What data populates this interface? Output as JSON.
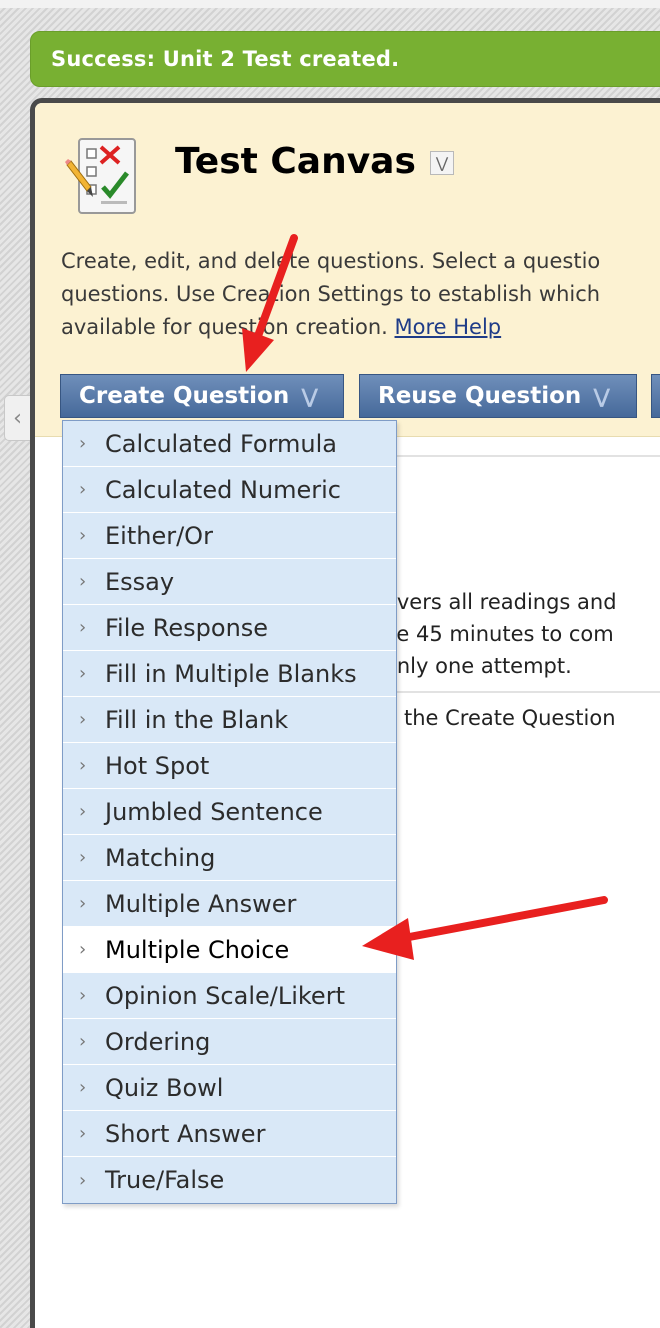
{
  "notification": {
    "text": "Success: Unit 2 Test created."
  },
  "header": {
    "title": "Test Canvas",
    "icon": "test-checklist-icon",
    "description_lines": [
      "Create, edit, and delete questions. Select a questio",
      "questions. Use Creation Settings to establish which",
      "available for question creation."
    ],
    "more_help": "More Help"
  },
  "toolbar": {
    "create_question": "Create Question",
    "reuse_question": "Reuse Question"
  },
  "create_question_menu": {
    "items": [
      "Calculated Formula",
      "Calculated Numeric",
      "Either/Or",
      "Essay",
      "File Response",
      "Fill in Multiple Blanks",
      "Fill in the Blank",
      "Hot Spot",
      "Jumbled Sentence",
      "Matching",
      "Multiple Answer",
      "Multiple Choice",
      "Opinion Scale/Likert",
      "Ordering",
      "Quiz Bowl",
      "Short Answer",
      "True/False"
    ],
    "highlighted": "Multiple Choice"
  },
  "content": {
    "description_lines": [
      "overs all readings and",
      "ve 45 minutes to com",
      "only one attempt."
    ],
    "hint": "n the Create Question"
  },
  "colors": {
    "success": "#78b032",
    "header_bg": "#fcf2d2",
    "button": "#4f71a1",
    "menu_bg": "#d9e8f7",
    "arrow": "#e8201f"
  }
}
